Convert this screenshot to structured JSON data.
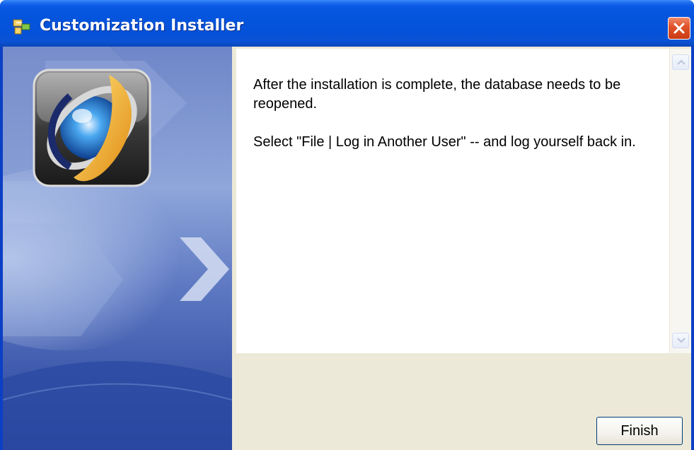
{
  "window": {
    "title": "Customization Installer",
    "title_icon": "installer-app-icon",
    "close_icon": "close-icon"
  },
  "side_panel": {
    "logo": "app-logo-emblem"
  },
  "message": {
    "line1": "After the installation is complete, the database needs to be reopened.",
    "line2": "Select \"File | Log in Another User\" -- and log yourself back in."
  },
  "scrollbar": {
    "up_icon": "scroll-up-arrow-icon",
    "down_icon": "scroll-down-arrow-icon"
  },
  "buttons": {
    "finish_label": "Finish"
  },
  "colors": {
    "titlebar": "#0454dc",
    "close": "#e2542b",
    "panel_bg": "#5874c0",
    "dialog_bg": "#ece9d8"
  }
}
